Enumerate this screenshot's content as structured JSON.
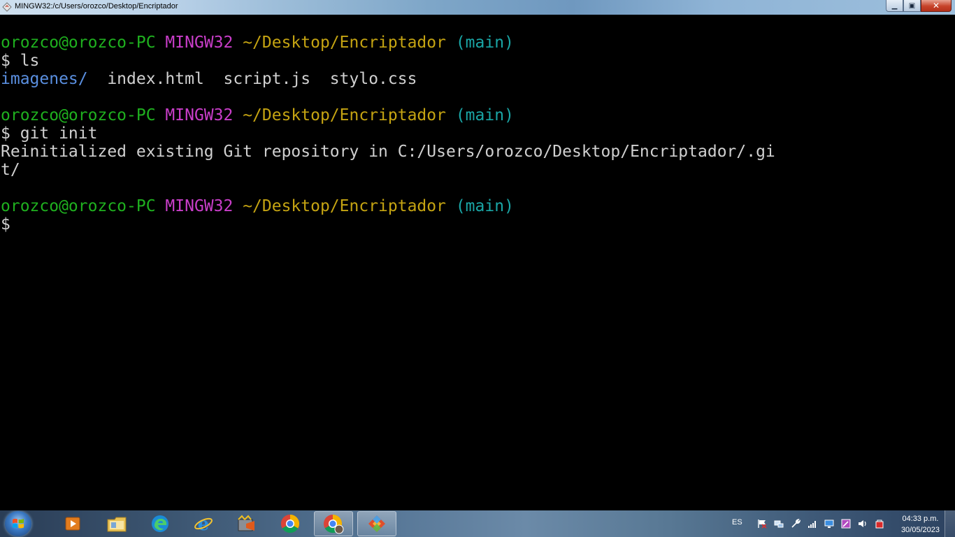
{
  "window": {
    "title": "MINGW32:/c/Users/orozco/Desktop/Encriptador",
    "buttons": {
      "minimize": "▁",
      "maximize": "▣",
      "close": "✕"
    }
  },
  "terminal": {
    "lines": [
      [
        {
          "t": "orozco@orozco-PC ",
          "c": "user"
        },
        {
          "t": "MINGW32 ",
          "c": "sys"
        },
        {
          "t": "~/Desktop/Encriptador ",
          "c": "path"
        },
        {
          "t": "(main)",
          "c": "branch"
        }
      ],
      [
        {
          "t": "$ ls",
          "c": "text"
        }
      ],
      [
        {
          "t": "imagenes/",
          "c": "dir"
        },
        {
          "t": "  index.html  script.js  stylo.css",
          "c": "text"
        }
      ],
      [
        {
          "t": "",
          "c": "text"
        }
      ],
      [
        {
          "t": "orozco@orozco-PC ",
          "c": "user"
        },
        {
          "t": "MINGW32 ",
          "c": "sys"
        },
        {
          "t": "~/Desktop/Encriptador ",
          "c": "path"
        },
        {
          "t": "(main)",
          "c": "branch"
        }
      ],
      [
        {
          "t": "$ git init",
          "c": "text"
        }
      ],
      [
        {
          "t": "Reinitialized existing Git repository in C:/Users/orozco/Desktop/Encriptador/.gi",
          "c": "text"
        }
      ],
      [
        {
          "t": "t/",
          "c": "text"
        }
      ],
      [
        {
          "t": "",
          "c": "text"
        }
      ],
      [
        {
          "t": "orozco@orozco-PC ",
          "c": "user"
        },
        {
          "t": "MINGW32 ",
          "c": "sys"
        },
        {
          "t": "~/Desktop/Encriptador ",
          "c": "path"
        },
        {
          "t": "(main)",
          "c": "branch"
        }
      ],
      [
        {
          "t": "$ ",
          "c": "text"
        }
      ]
    ]
  },
  "taskbar": {
    "items": [
      {
        "name": "media-player-icon"
      },
      {
        "name": "file-explorer-icon"
      },
      {
        "name": "edge-icon"
      },
      {
        "name": "internet-explorer-icon"
      },
      {
        "name": "video-editor-icon"
      },
      {
        "name": "chrome-icon"
      },
      {
        "name": "chrome-profile-icon",
        "active": true
      },
      {
        "name": "git-bash-icon",
        "active": true
      }
    ],
    "tray": {
      "language": "ES",
      "icons": [
        "flag-icon",
        "network-manager-icon",
        "wrench-icon",
        "signal-icon",
        "monitor-icon",
        "pen-icon",
        "volume-icon",
        "security-icon"
      ]
    },
    "clock": {
      "time": "04:33 p.m.",
      "date": "30/05/2023"
    }
  },
  "colors": {
    "user": "#1fb01f",
    "system": "#c93ec9",
    "path": "#c5a412",
    "branch": "#1aa6a6",
    "directory": "#5a8fe0",
    "text": "#d0d0d0"
  }
}
